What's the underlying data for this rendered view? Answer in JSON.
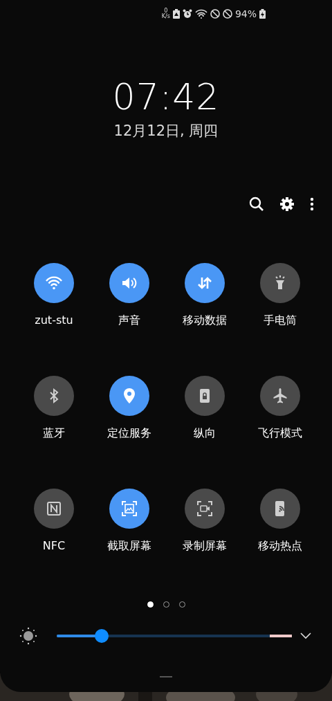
{
  "status_bar": {
    "net_speed_value": "0",
    "net_speed_unit": "K/s",
    "battery": "94%"
  },
  "clock": {
    "time": "07:42",
    "date": "12月12日, 周四"
  },
  "tiles": [
    {
      "label": "zut-stu",
      "on": true
    },
    {
      "label": "声音",
      "on": true
    },
    {
      "label": "移动数据",
      "on": true
    },
    {
      "label": "手电筒",
      "on": false
    },
    {
      "label": "蓝牙",
      "on": false
    },
    {
      "label": "定位服务",
      "on": true
    },
    {
      "label": "纵向",
      "on": false
    },
    {
      "label": "飞行模式",
      "on": false
    },
    {
      "label": "NFC",
      "on": false
    },
    {
      "label": "截取屏幕",
      "on": true
    },
    {
      "label": "录制屏幕",
      "on": false
    },
    {
      "label": "移动热点",
      "on": false
    }
  ],
  "pages": [
    {
      "selected": true
    },
    {
      "selected": false
    },
    {
      "selected": false
    }
  ],
  "brightness": {
    "level": 0.19
  }
}
